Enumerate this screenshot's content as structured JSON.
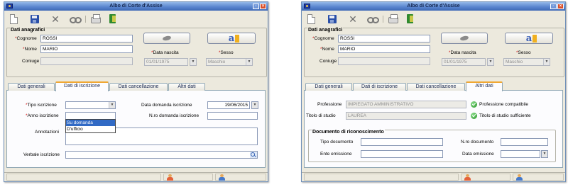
{
  "windows": [
    {
      "title": "Albo di Corte d'Assise",
      "group_title": "Dati anagrafici",
      "fields": {
        "cognome_label": "Cognome",
        "cognome_value": "ROSSI",
        "nome_label": "Nome",
        "nome_value": "MARIO",
        "coniuge_label": "Coniuge",
        "coniuge_value": "",
        "data_nascita_label": "Data nascita",
        "data_nascita_value": "01/01/1975",
        "sesso_label": "Sesso",
        "sesso_value": "Maschio"
      },
      "tabs": [
        "Dati generali",
        "Dati di iscrizione",
        "Dati cancellazione",
        "Altri dati"
      ],
      "active_tab": 1,
      "iscrizione": {
        "tipo_label": "Tipo iscrizione",
        "tipo_value": "",
        "tipo_options": [
          "Su domanda",
          "D'ufficio"
        ],
        "anno_label": "Anno iscrizione",
        "annotazioni_label": "Annotazioni",
        "verbale_label": "Verbale iscrizione",
        "data_domanda_label": "Data domanda iscrizione",
        "data_domanda_value": "19/06/2015",
        "nro_domanda_label": "N.ro domanda iscrizione",
        "nro_domanda_value": ""
      }
    },
    {
      "title": "Albo di Corte d'Assise",
      "group_title": "Dati anagrafici",
      "fields": {
        "cognome_label": "Cognome",
        "cognome_value": "ROSSI",
        "nome_label": "Nome",
        "nome_value": "MARIO",
        "coniuge_label": "Coniuge",
        "coniuge_value": "",
        "data_nascita_label": "Data nascita",
        "data_nascita_value": "01/01/1975",
        "sesso_label": "Sesso",
        "sesso_value": "Maschio"
      },
      "tabs": [
        "Dati generali",
        "Dati di iscrizione",
        "Dati cancellazione",
        "Altri dati"
      ],
      "active_tab": 3,
      "altri_dati": {
        "professione_label": "Professione",
        "professione_value": "IMPIEGATO AMMINISTRATIVO",
        "professione_status": "Professione compatibile",
        "titolo_label": "Titolo di studio",
        "titolo_value": "LAUREA",
        "titolo_status": "Titolo di studio sufficiente",
        "documento_group": "Documento di riconoscimento",
        "tipo_doc_label": "Tipo documento",
        "tipo_doc_value": "",
        "nro_doc_label": "N.ro documento",
        "nro_doc_value": "",
        "ente_label": "Ente emissione",
        "ente_value": "",
        "data_emissione_label": "Data emissione",
        "data_emissione_value": ""
      }
    }
  ],
  "icons": {
    "toolbar": [
      "new-document-icon",
      "save-icon",
      "delete-icon",
      "search-icon",
      "print-icon",
      "exit-icon"
    ],
    "statusbar": [
      "user-icon",
      "user-icon"
    ]
  },
  "colors": {
    "titlebar": "#5a86cf",
    "required_asterisk": "#d01010",
    "active_tab_accent": "#f0a732",
    "dropdown_selection": "#316ac5"
  }
}
